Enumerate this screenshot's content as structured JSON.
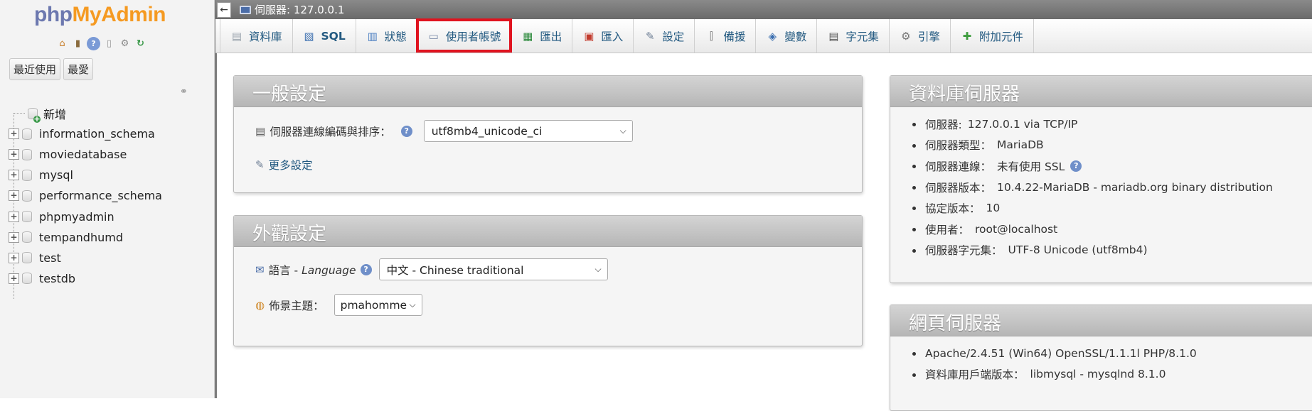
{
  "sidebar": {
    "logo": {
      "php": "php",
      "my": "My",
      "admin": "Admin"
    },
    "quick_icons": [
      "home-icon",
      "exit-icon",
      "help-icon",
      "docs-icon",
      "settings-icon",
      "reload-icon"
    ],
    "buttons": {
      "recent": "最近使用",
      "favorites": "最愛"
    },
    "tree": {
      "new": "新增",
      "databases": [
        "information_schema",
        "moviedatabase",
        "mysql",
        "performance_schema",
        "phpmyadmin",
        "tempandhumd",
        "test",
        "testdb"
      ]
    }
  },
  "topbar": {
    "back": "←",
    "breadcrumb": "伺服器: 127.0.0.1"
  },
  "tabs": [
    {
      "label": "資料庫",
      "icon": "database-icon",
      "glyph": "▤"
    },
    {
      "label": "SQL",
      "icon": "sql-icon",
      "glyph": "▧"
    },
    {
      "label": "狀態",
      "icon": "status-icon",
      "glyph": "▥"
    },
    {
      "label": "使用者帳號",
      "icon": "users-icon",
      "glyph": "▭",
      "active": true
    },
    {
      "label": "匯出",
      "icon": "export-icon",
      "glyph": "▦"
    },
    {
      "label": "匯入",
      "icon": "import-icon",
      "glyph": "▣"
    },
    {
      "label": "設定",
      "icon": "wrench-icon",
      "glyph": "✎"
    },
    {
      "label": "備援",
      "icon": "replication-icon",
      "glyph": "⫿"
    },
    {
      "label": "變數",
      "icon": "variables-icon",
      "glyph": "◈"
    },
    {
      "label": "字元集",
      "icon": "charset-icon",
      "glyph": "▤"
    },
    {
      "label": "引擎",
      "icon": "engine-icon",
      "glyph": "⚙"
    },
    {
      "label": "附加元件",
      "icon": "plugin-icon",
      "glyph": "✚"
    }
  ],
  "general": {
    "title": "一般設定",
    "collation_label": "伺服器連線編碼與排序：",
    "collation_value": "utf8mb4_unicode_ci",
    "more_settings": "更多設定"
  },
  "appearance": {
    "title": "外觀設定",
    "language_label": "語言",
    "language_label_en": "Language",
    "language_separator": "-",
    "language_value": "中文 - Chinese traditional",
    "theme_label": "佈景主題：",
    "theme_value": "pmahomme"
  },
  "db_server": {
    "title": "資料庫伺服器",
    "items": [
      {
        "label": "伺服器:",
        "value": "127.0.0.1 via TCP/IP"
      },
      {
        "label": "伺服器類型：",
        "value": "MariaDB"
      },
      {
        "label": "伺服器連線：",
        "value": "未有使用 SSL"
      },
      {
        "label": "伺服器版本：",
        "value": "10.4.22-MariaDB - mariadb.org binary distribution"
      },
      {
        "label": "協定版本：",
        "value": "10"
      },
      {
        "label": "使用者：",
        "value": "root@localhost"
      },
      {
        "label": "伺服器字元集：",
        "value": "UTF-8 Unicode (utf8mb4)"
      }
    ]
  },
  "web_server": {
    "title": "網頁伺服器",
    "items": [
      {
        "label": "Apache/2.4.51 (Win64) OpenSSL/1.1.1l PHP/8.1.0",
        "value": ""
      },
      {
        "label": "資料庫用戶端版本：",
        "value": "libmysql - mysqlnd 8.1.0"
      }
    ]
  },
  "colors": {
    "accent_link": "#235a81",
    "active_highlight": "#e0131f",
    "logo_php": "#6c78af",
    "logo_admin": "#f59a22"
  }
}
